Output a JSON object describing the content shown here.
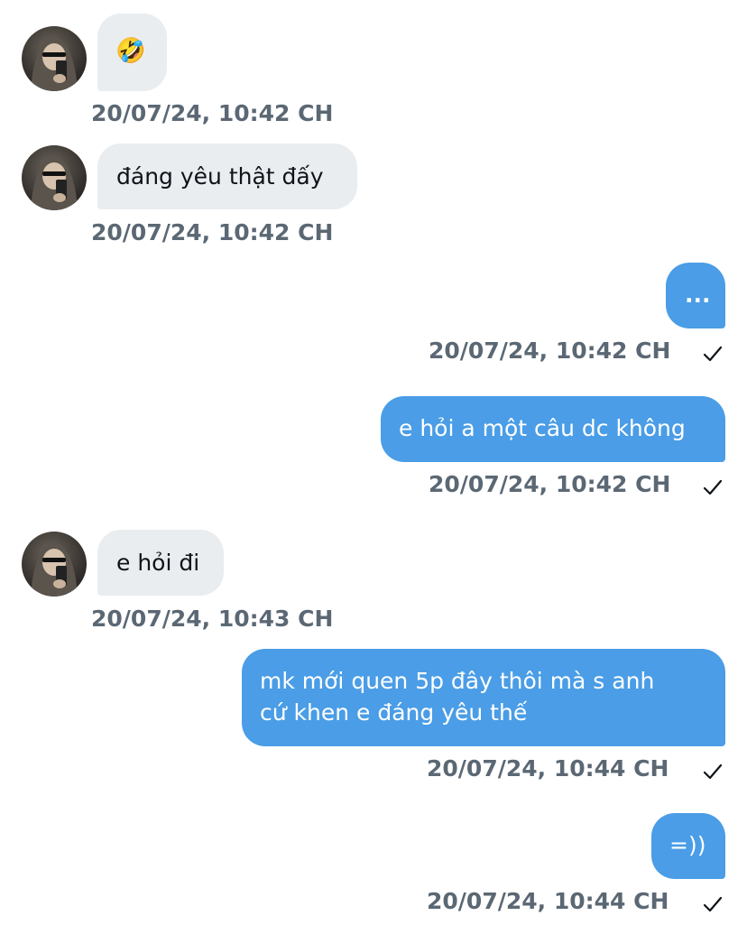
{
  "colors": {
    "incoming_bubble": "#e9edf0",
    "outgoing_bubble": "#4a9de6",
    "timestamp": "#5b6874"
  },
  "messages": [
    {
      "direction": "incoming",
      "text": "🤣",
      "timestamp": "20/07/24, 10:42 CH"
    },
    {
      "direction": "incoming",
      "text": "đáng yêu thật đấy",
      "timestamp": "20/07/24, 10:42 CH"
    },
    {
      "direction": "outgoing",
      "text": "...",
      "timestamp": "20/07/24, 10:42 CH",
      "read_icon": "checkmark-icon"
    },
    {
      "direction": "outgoing",
      "text": "e hỏi a một câu dc không",
      "timestamp": "20/07/24, 10:42 CH",
      "read_icon": "checkmark-icon"
    },
    {
      "direction": "incoming",
      "text": "e hỏi đi",
      "timestamp": "20/07/24, 10:43 CH"
    },
    {
      "direction": "outgoing",
      "text_lines": [
        "mk mới quen 5p đây thôi mà s anh",
        "cứ khen e đáng yêu thế"
      ],
      "timestamp": "20/07/24, 10:44 CH",
      "read_icon": "checkmark-icon"
    },
    {
      "direction": "outgoing",
      "text": "=))",
      "timestamp": "20/07/24, 10:44 CH",
      "read_icon": "checkmark-icon"
    }
  ]
}
